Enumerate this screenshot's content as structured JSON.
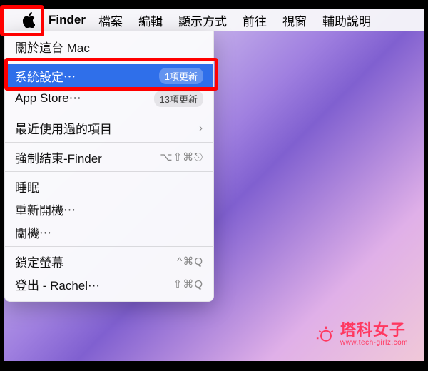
{
  "menubar": {
    "app_name": "Finder",
    "items": [
      "檔案",
      "編輯",
      "顯示方式",
      "前往",
      "視窗",
      "輔助說明"
    ]
  },
  "dropdown": {
    "about": "關於這台 Mac",
    "system_settings": {
      "label": "系統設定⋯",
      "badge": "1項更新"
    },
    "app_store": {
      "label": "App Store⋯",
      "badge": "13項更新"
    },
    "recent_items": {
      "label": "最近使用過的項目",
      "chevron": "›"
    },
    "force_quit": {
      "label": "強制結束-Finder",
      "shortcut": "⌥⇧⌘⎋"
    },
    "sleep": "睡眠",
    "restart": "重新開機⋯",
    "shutdown": "關機⋯",
    "lock_screen": {
      "label": "鎖定螢幕",
      "shortcut": "^⌘Q"
    },
    "logout": {
      "label": "登出 - Rachel⋯",
      "shortcut": "⇧⌘Q"
    }
  },
  "watermark": {
    "title": "塔科女子",
    "url": "www.tech-girlz.com"
  }
}
